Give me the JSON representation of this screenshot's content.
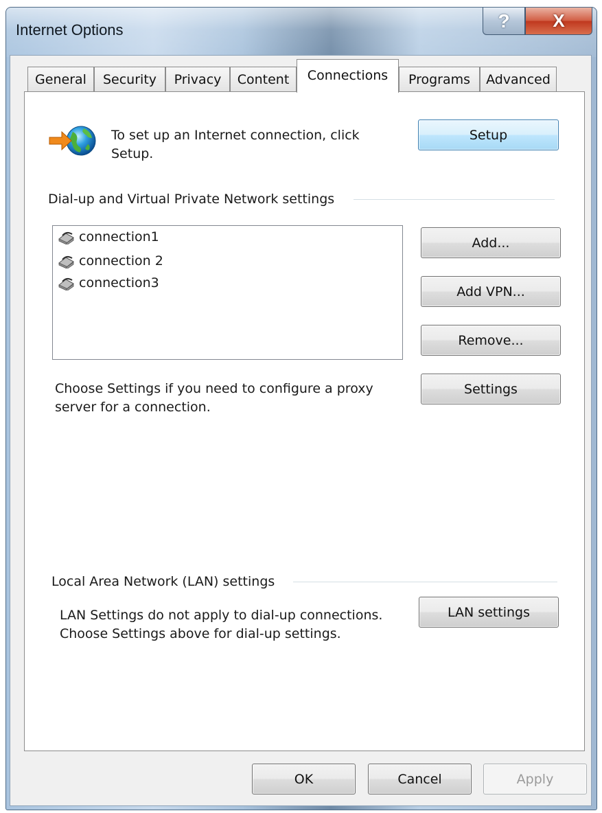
{
  "window": {
    "title": "Internet Options",
    "help_glyph": "?",
    "close_glyph": "X"
  },
  "tabs": [
    {
      "label": "General"
    },
    {
      "label": "Security"
    },
    {
      "label": "Privacy"
    },
    {
      "label": "Content"
    },
    {
      "label": "Connections",
      "active": true
    },
    {
      "label": "Programs"
    },
    {
      "label": "Advanced"
    }
  ],
  "setup": {
    "text": "To set up an Internet connection, click Setup.",
    "button": "Setup"
  },
  "dialup": {
    "group_label": "Dial-up and Virtual Private Network settings",
    "connections": [
      "connection1",
      "connection 2",
      "connection3"
    ],
    "add_button": "Add...",
    "add_vpn_button": "Add VPN...",
    "remove_button": "Remove...",
    "settings_button": "Settings",
    "proxy_text": "Choose Settings if you need to configure a proxy server for a connection."
  },
  "lan": {
    "group_label": "Local Area Network (LAN) settings",
    "text": "LAN Settings do not apply to dial-up connections. Choose Settings above for dial-up settings.",
    "button": "LAN settings"
  },
  "footer": {
    "ok": "OK",
    "cancel": "Cancel",
    "apply": "Apply"
  }
}
